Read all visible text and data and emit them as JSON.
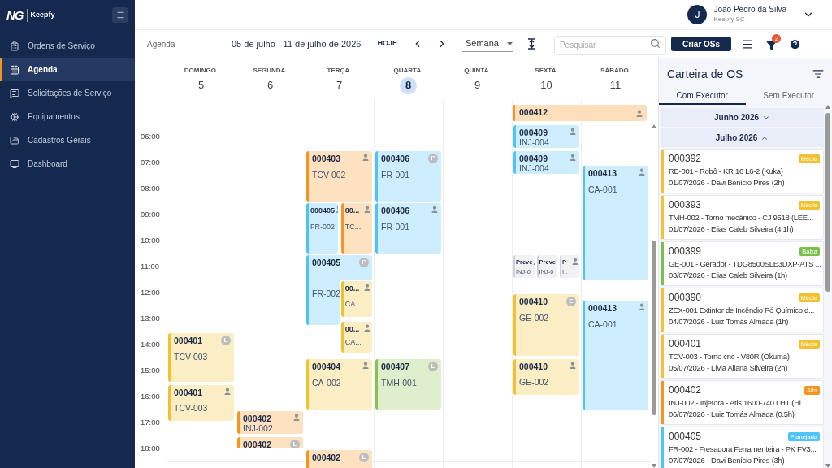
{
  "sidebar": {
    "logo": {
      "mark": "NG",
      "name": "Keepfy"
    },
    "items": [
      {
        "label": "Ordens de Serviço",
        "selected": false
      },
      {
        "label": "Agenda",
        "selected": true
      },
      {
        "label": "Solicitações de Serviço",
        "selected": false
      },
      {
        "label": "Equipamentos",
        "selected": false
      },
      {
        "label": "Cadastros Gerais",
        "selected": false
      },
      {
        "label": "Dashboard",
        "selected": false
      }
    ]
  },
  "user": {
    "initial": "J",
    "name": "João Pedro da Silva",
    "company": "Keepfy SC"
  },
  "toolbar": {
    "breadcrumb": "Agenda",
    "date_range": "05 de julho - 11 de julho de 2026",
    "today_button": "HOJE",
    "view_select": "Semana",
    "search": {
      "placeholder": "Pesquisar"
    },
    "create_button": "Criar OSs",
    "filter_count": "2"
  },
  "calendar": {
    "days": [
      {
        "name": "DOMINGO.",
        "date": "5",
        "selected": false,
        "events": [
          {
            "id": "000401",
            "code": "TCV-003",
            "badge": "L",
            "color": "#f2c12e"
          },
          {
            "id": "000401",
            "code": "TCV-003",
            "color": "#f2c12e"
          }
        ]
      },
      {
        "name": "SEGUNDA.",
        "date": "6",
        "selected": false,
        "events": [
          {
            "id": "000402",
            "code": "INJ-002",
            "color": "#f7941d"
          },
          {
            "id": "000402",
            "badge": "L",
            "color": "#f7941d"
          }
        ]
      },
      {
        "name": "TERÇA.",
        "date": "7",
        "selected": false,
        "events": [
          {
            "id": "000403",
            "code": "TCV-002",
            "color": "#f7941d"
          },
          {
            "id": "000405",
            "code": "FR-002",
            "color": "#4fc3f7"
          },
          {
            "id": "00...",
            "code": "TC...",
            "color": "#f7941d"
          },
          {
            "id": "000405",
            "code": "FR-002",
            "badge": "P",
            "color": "#4fc3f7"
          },
          {
            "id": "00...",
            "code": "CA...",
            "color": "#f2c12e"
          },
          {
            "id": "00...",
            "code": "CA...",
            "color": "#f2c12e"
          },
          {
            "id": "000404",
            "code": "CA-002",
            "color": "#f2c12e"
          },
          {
            "id": "000402",
            "badge": "L",
            "color": "#f7941d"
          }
        ]
      },
      {
        "name": "QUARTA.",
        "date": "8",
        "selected": true,
        "events": [
          {
            "id": "000406",
            "code": "FR-001",
            "badge": "P",
            "color": "#4fc3f7"
          },
          {
            "id": "000406",
            "code": "FR-001",
            "color": "#4fc3f7"
          },
          {
            "id": "000407",
            "code": "TMH-001",
            "badge": "L",
            "color": "#8bc34a"
          }
        ]
      },
      {
        "name": "QUINTA.",
        "date": "9",
        "selected": false
      },
      {
        "name": "SEXTA.",
        "date": "10",
        "selected": false,
        "events": [
          {
            "id": "000409",
            "code": "INJ-004",
            "color": "#4fc3f7"
          },
          {
            "id": "000409",
            "code": "INJ-004",
            "color": "#4fc3f7"
          },
          {
            "id": "Preve",
            "code": "INJ-0",
            "color": "#cfd0d8"
          },
          {
            "id": "Preve",
            "code": "INJ-0",
            "color": "#cfd0d8"
          },
          {
            "id": "P",
            "code": "I..",
            "color": "#cfd0d8"
          },
          {
            "id": "000410",
            "code": "GE-002",
            "badge": "E",
            "color": "#f2c12e"
          },
          {
            "id": "000410",
            "code": "GE-002",
            "color": "#f2c12e"
          }
        ]
      },
      {
        "name": "SÁBADO.",
        "date": "11",
        "selected": false,
        "events": [
          {
            "id": "000413",
            "code": "CA-001",
            "color": "#4fc3f7"
          },
          {
            "id": "000413",
            "code": "CA-001",
            "color": "#4fc3f7"
          }
        ]
      }
    ],
    "all_day": [
      {
        "id": "000412",
        "color": "#f7941d"
      }
    ],
    "hours": [
      "06:00",
      "07:00",
      "08:00",
      "09:00",
      "10:00",
      "11:00",
      "12:00",
      "13:00",
      "14:00",
      "15:00",
      "16:00",
      "17:00",
      "18:00"
    ]
  },
  "panel": {
    "title": "Carteira de OS",
    "tabs": [
      {
        "label": "Com Executor",
        "selected": true
      },
      {
        "label": "Sem Executor",
        "selected": false
      }
    ],
    "groups": [
      {
        "label": "Junho 2026",
        "expanded": false
      },
      {
        "label": "Julho 2026",
        "expanded": true
      }
    ],
    "cards": [
      {
        "id": "000392",
        "priority": "Média",
        "color": "#f2c12e",
        "equipment": "RB-001 - Robô - KR 16 L6-2 (Kuka)",
        "schedule": "01/07/2026 - Davi Benício Pires (2h)"
      },
      {
        "id": "000393",
        "priority": "Média",
        "color": "#f2c12e",
        "equipment": "TMH-002 - Torno mecânico - CJ 9518 (LEE...",
        "schedule": "01/07/2026 - Elias Caleb Silveira (4.1h)"
      },
      {
        "id": "000399",
        "priority": "Baixa",
        "color": "#7cbf4a",
        "equipment": "GE-001 - Gerador - TDG8500SLE3DXP-ATS ...",
        "schedule": "03/07/2026 - Elias Caleb Silveira (1h)"
      },
      {
        "id": "000390",
        "priority": "Média",
        "color": "#f2c12e",
        "equipment": "ZEX-001 Extintor de Incêndio Pó Químico d...",
        "schedule": "04/07/2026 - Luiz Tomás Almada (1h)"
      },
      {
        "id": "000401",
        "priority": "Média",
        "color": "#f2c12e",
        "equipment": "TCV-003 - Torno cnc - V80R (Okuma)",
        "schedule": "05/07/2026 - Lívia Allana Silveira (2h)"
      },
      {
        "id": "000402",
        "priority": "Alta",
        "color": "#f7941d",
        "equipment": "INJ-002 - Injetora - Atis 1600-740 LHT (Hi...",
        "schedule": "06/07/2026 - Luiz Tomás Almada (0.5h)"
      },
      {
        "id": "000405",
        "priority": "Planejada",
        "color": "#4fc3f7",
        "equipment": "FR-002 - Fresadora Ferramenteira - PK FV3...",
        "schedule": "07/07/2026 - Davi Benício Pires (3h)"
      }
    ]
  }
}
